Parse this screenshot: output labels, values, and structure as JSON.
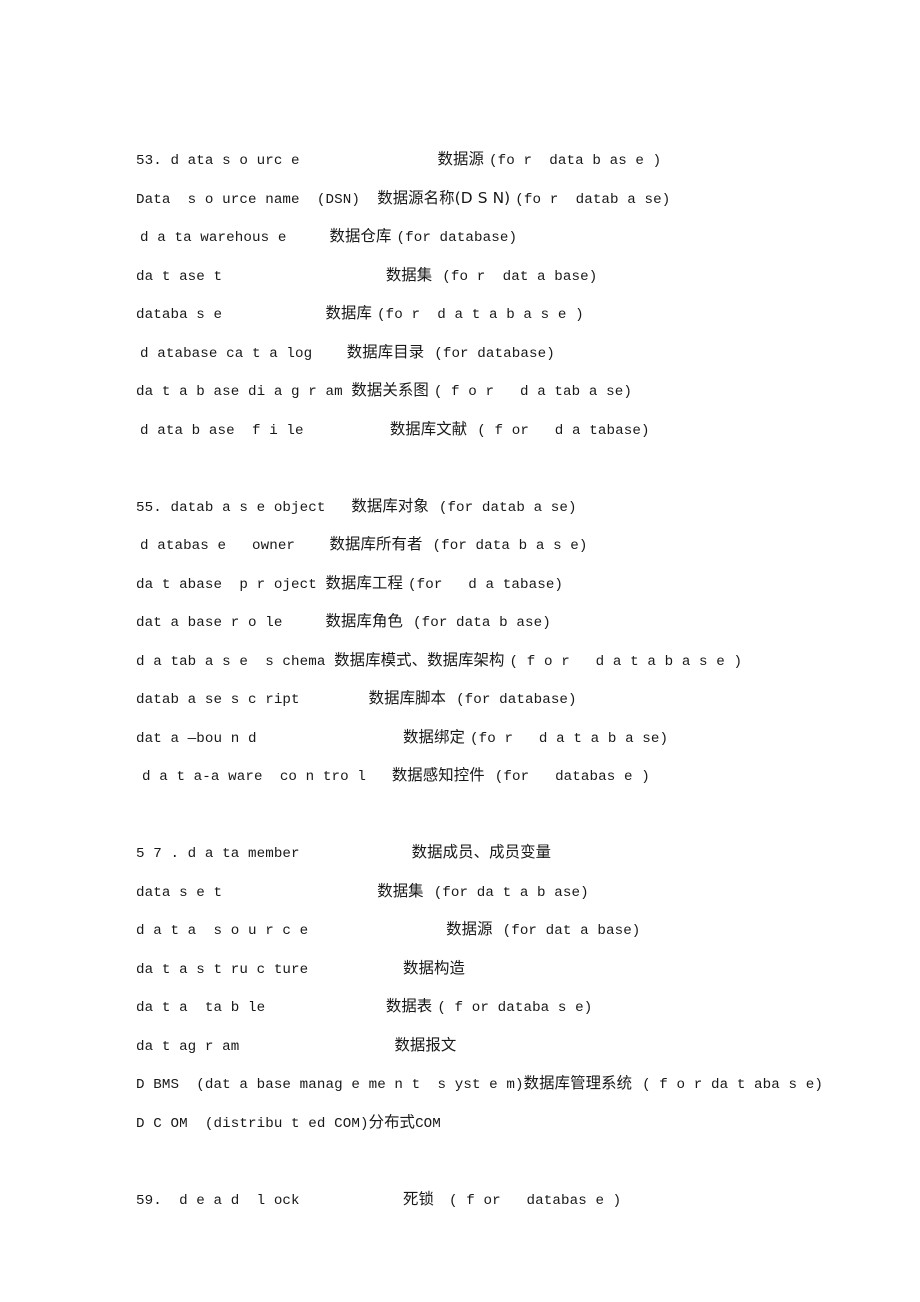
{
  "document": {
    "type": "glossary",
    "language_pair": "English-Chinese",
    "page_background": "#ffffff",
    "text_color": "#181818"
  },
  "lines": [
    {
      "id": "l1",
      "indent": 0,
      "en": "53. d ata s o urc e",
      "gap_a": "                ",
      "cn": "数据源",
      "gap_b": " ",
      "tag": "(fo r  data b as e )"
    },
    {
      "id": "l2",
      "indent": 0,
      "en": "Data  s o urce name  (DSN)",
      "gap_a": "  ",
      "cn": "数据源名称(D S N)",
      "gap_b": " ",
      "tag": "(fo r  datab a se)"
    },
    {
      "id": "l3",
      "indent": 4,
      "en": "d a ta warehous e",
      "gap_a": "     ",
      "cn": "数据仓库",
      "gap_b": " ",
      "tag": "(for database)"
    },
    {
      "id": "l4",
      "indent": 0,
      "en": "da t ase t",
      "gap_a": "                   ",
      "cn": "数据集",
      "gap_b": "  ",
      "tag": "(fo r  dat a base)"
    },
    {
      "id": "l5",
      "indent": 0,
      "en": "databa s e",
      "gap_a": "            ",
      "cn": "数据库",
      "gap_b": " ",
      "tag": "(fo r  d a t a b a s e )"
    },
    {
      "id": "l6",
      "indent": 4,
      "en": "d atabase ca t a log",
      "gap_a": "    ",
      "cn": "数据库目录",
      "gap_b": "  ",
      "tag": "(for database)"
    },
    {
      "id": "l7",
      "indent": 0,
      "en": "da t a b ase di a g r am",
      "gap_a": " ",
      "cn": "数据关系图",
      "gap_b": " ",
      "tag": "( f o r   d a tab a se)"
    },
    {
      "id": "l8",
      "indent": 4,
      "en": "d ata b ase  f i le",
      "gap_a": "          ",
      "cn": "数据库文献",
      "gap_b": "  ",
      "tag": "( f or   d a tabase)"
    },
    {
      "id": "l9",
      "indent": 0,
      "en": "55. datab a s e object",
      "gap_a": "   ",
      "cn": "数据库对象",
      "gap_b": "  ",
      "tag": "(for datab a se)"
    },
    {
      "id": "l10",
      "indent": 4,
      "en": "d atabas e   owner",
      "gap_a": "    ",
      "cn": "数据库所有者",
      "gap_b": "  ",
      "tag": "(for data b a s e)"
    },
    {
      "id": "l11",
      "indent": 0,
      "en": "da t abase  p r oject",
      "gap_a": " ",
      "cn": "数据库工程",
      "gap_b": " ",
      "tag": "(for   d a tabase)"
    },
    {
      "id": "l12",
      "indent": 0,
      "en": "dat a base r o le",
      "gap_a": "     ",
      "cn": "数据库角色",
      "gap_b": "  ",
      "tag": "(for data b ase)"
    },
    {
      "id": "l13",
      "indent": 0,
      "en": "d a tab a s e  s chema",
      "gap_a": " ",
      "cn": "数据库模式、数据库架构",
      "gap_b": " ",
      "tag": "( f o r   d a t a b a s e )"
    },
    {
      "id": "l14",
      "indent": 0,
      "en": "datab a se s c ript",
      "gap_a": "        ",
      "cn": "数据库脚本",
      "gap_b": "  ",
      "tag": "(for database)"
    },
    {
      "id": "l15",
      "indent": 0,
      "en": "dat a —bou n d",
      "gap_a": "                 ",
      "cn": "数据绑定",
      "gap_b": " ",
      "tag": "(fo r   d a t a b a se)"
    },
    {
      "id": "l16",
      "indent": 6,
      "en": "d a t a-a ware  co n tro l",
      "gap_a": "   ",
      "cn": "数据感知控件",
      "gap_b": "  ",
      "tag": "(for   databas e )"
    },
    {
      "id": "l17",
      "indent": 0,
      "en": "5 7 . d a ta member",
      "gap_a": "             ",
      "cn": "数据成员、成员变量",
      "gap_b": "",
      "tag": ""
    },
    {
      "id": "l18",
      "indent": 0,
      "en": "data s e t",
      "gap_a": "                  ",
      "cn": "数据集",
      "gap_b": "  ",
      "tag": "(for da t a b ase)"
    },
    {
      "id": "l19",
      "indent": 0,
      "en": "d a t a  s o u r c e",
      "gap_a": "                ",
      "cn": "数据源",
      "gap_b": "  ",
      "tag": "(for dat a base)"
    },
    {
      "id": "l20",
      "indent": 0,
      "en": "da t a s t ru c ture",
      "gap_a": "           ",
      "cn": "数据构造",
      "gap_b": "",
      "tag": ""
    },
    {
      "id": "l21",
      "indent": 0,
      "en": "da t a  ta b le",
      "gap_a": "              ",
      "cn": "数据表",
      "gap_b": " ",
      "tag": "( f or databa s e)"
    },
    {
      "id": "l22",
      "indent": 0,
      "en": "da t ag r am",
      "gap_a": "                  ",
      "cn": "数据报文",
      "gap_b": "",
      "tag": ""
    },
    {
      "id": "l23",
      "indent": 0,
      "en": "D BMS  (dat a base manag e me n t  s yst e m)",
      "gap_a": "",
      "cn": "数据库管理系统",
      "gap_b": "  ",
      "tag": "( f o r da t aba s e)"
    },
    {
      "id": "l24",
      "indent": 0,
      "en": "D C OM  (distribu t ed COM)",
      "gap_a": "",
      "cn": "分布式",
      "gap_b": "",
      "tag": "COM"
    },
    {
      "id": "l25",
      "indent": 0,
      "en": "59.  d e a d  l ock",
      "gap_a": "            ",
      "cn": "死锁",
      "gap_b": "   ",
      "tag": "( f or   databas e )"
    }
  ],
  "gaps_after": [
    "l8",
    "l16",
    "l24"
  ]
}
